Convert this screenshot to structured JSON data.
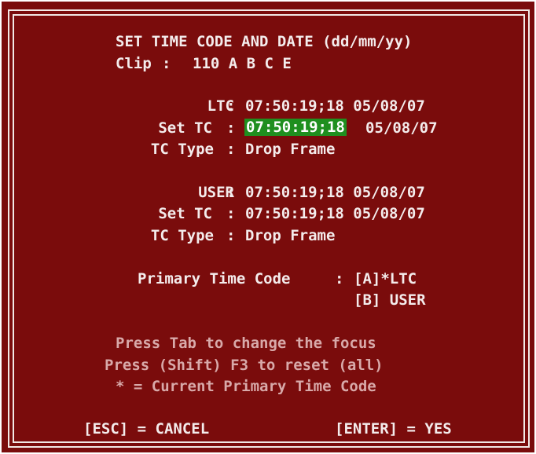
{
  "header": {
    "title": "SET TIME CODE AND DATE (dd/mm/yy)",
    "clip_label": "Clip",
    "clip_value": "110 A B C E"
  },
  "ltc": {
    "label": "LTC",
    "value": "07:50:19;18 05/08/07",
    "set_label": "Set TC",
    "set_tc": "07:50:19;18",
    "set_date": "05/08/07",
    "type_label": "TC Type",
    "type_value": "Drop Frame"
  },
  "user": {
    "label": "USER",
    "value": "07:50:19;18 05/08/07",
    "set_label": "Set TC",
    "set_value": "07:50:19;18 05/08/07",
    "type_label": "TC Type",
    "type_value": "Drop Frame"
  },
  "primary": {
    "label": "Primary Time Code",
    "option_a": "[A]*LTC",
    "option_b": "[B] USER"
  },
  "help": {
    "line1": "Press Tab to change the focus",
    "line2": "Press (Shift) F3 to reset (all)",
    "line3": "* = Current Primary Time Code"
  },
  "footer": {
    "cancel": "[ESC] = CANCEL",
    "yes": "[ENTER] = YES"
  },
  "separator": ":",
  "colors": {
    "background": "#7a0c0c",
    "text": "#f4ecec",
    "focus_highlight": "#1f8f1f"
  }
}
